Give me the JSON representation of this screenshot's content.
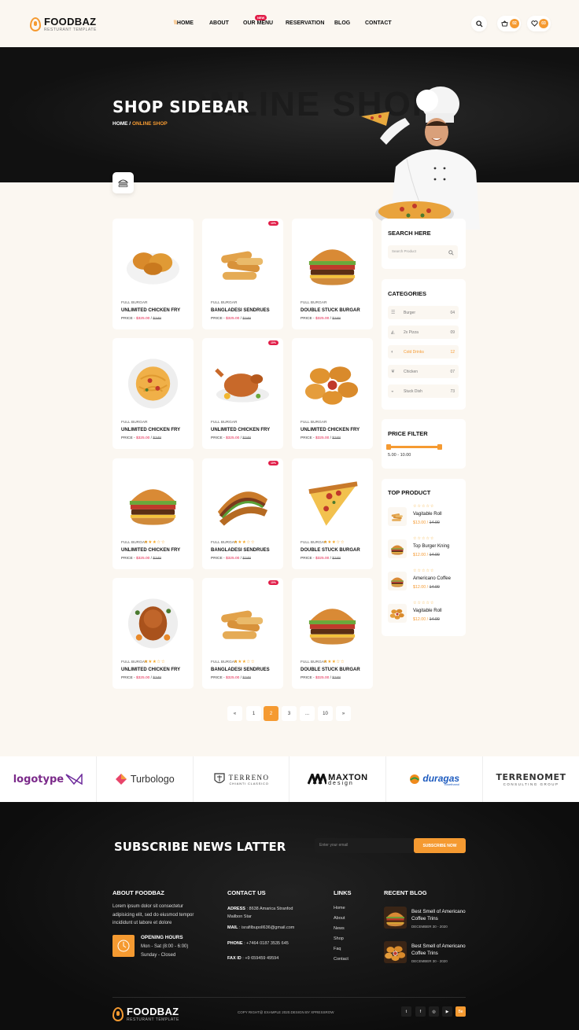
{
  "header": {
    "logo_text": "FOODBAZ",
    "logo_sub": "RESTURANT TEMPLATE",
    "nav": [
      "\\\\HOME",
      "ABOUT",
      "OUR MENU",
      "RESERVATION",
      "BLOG",
      "CONTACT"
    ],
    "new_badge": "NEW",
    "cart_count": "02",
    "wish_count": "03",
    "icons": [
      "search-icon",
      "basket-icon",
      "heart-icon"
    ]
  },
  "hero": {
    "bg_text": "ONLINE SHOP",
    "title": "SHOP SIDEBAR",
    "crumb_home": "HOME /",
    "crumb_current": "ONLINE SHOP"
  },
  "products": [
    {
      "cat": "FULL BURGAR",
      "name": "UNLIMITED CHICKEN FRY",
      "price_label": "PRICE - ",
      "price": "$325.00",
      "old": "$348",
      "badge": "",
      "stars": 0,
      "icon": "fried-chicken"
    },
    {
      "cat": "FULL BURGAR",
      "name": "BANGLADESI SENDRUES",
      "price_label": "PRICE - ",
      "price": "$325.00",
      "old": "$348",
      "badge": "10%",
      "stars": 0,
      "icon": "chicken-strips"
    },
    {
      "cat": "FULL BURGAR",
      "name": "DOUBLE STUCK BURGAR",
      "price_label": "PRICE - ",
      "price": "$325.00",
      "old": "$348",
      "badge": "",
      "stars": 0,
      "icon": "burger"
    },
    {
      "cat": "FULL BURGAR",
      "name": "UNLIMITED CHICKEN FRY",
      "price_label": "PRICE - ",
      "price": "$325.00",
      "old": "$348",
      "badge": "",
      "stars": 0,
      "icon": "spaghetti"
    },
    {
      "cat": "FULL BURGAR",
      "name": "UNLIMITED CHICKEN FRY",
      "price_label": "PRICE - ",
      "price": "$325.00",
      "old": "$348",
      "badge": "10%",
      "stars": 0,
      "icon": "roast-chicken"
    },
    {
      "cat": "FULL BURGAR",
      "name": "UNLIMITED CHICKEN FRY",
      "price_label": "PRICE - ",
      "price": "$325.00",
      "old": "$348",
      "badge": "",
      "stars": 0,
      "icon": "nuggets"
    },
    {
      "cat": "FULL BURGAR",
      "name": "UNLIMITED CHICKEN FRY",
      "price_label": "PRICE - ",
      "price": "$325.00",
      "old": "$348",
      "badge": "",
      "stars": 3,
      "icon": "burger"
    },
    {
      "cat": "FULL BURGAR",
      "name": "BANGLADESI SENDRUES",
      "price_label": "PRICE - ",
      "price": "$325.00",
      "old": "$348",
      "badge": "10%",
      "stars": 3,
      "icon": "sandwich"
    },
    {
      "cat": "FULL BURGAR",
      "name": "DOUBLE STUCK BURGAR",
      "price_label": "PRICE - ",
      "price": "$325.00",
      "old": "$348",
      "badge": "",
      "stars": 3,
      "icon": "pizza-slice"
    },
    {
      "cat": "FULL BURGAR",
      "name": "UNLIMITED CHICKEN FRY",
      "price_label": "PRICE - ",
      "price": "$325.00",
      "old": "$348",
      "badge": "",
      "stars": 3,
      "icon": "roast-turkey"
    },
    {
      "cat": "FULL BURGAR",
      "name": "BANGLADESI SENDRUES",
      "price_label": "PRICE - ",
      "price": "$325.00",
      "old": "$348",
      "badge": "10%",
      "stars": 3,
      "icon": "chicken-strips"
    },
    {
      "cat": "FULL BURGAR",
      "name": "DOUBLE STUCK BURGAR",
      "price_label": "PRICE - ",
      "price": "$325.00",
      "old": "$348",
      "badge": "",
      "stars": 3,
      "icon": "burger"
    }
  ],
  "sidebar": {
    "search_title": "SEARCH HERE",
    "search_placeholder": "Search Product",
    "categories_title": "CATEGORIES",
    "categories": [
      {
        "label": "Burger",
        "count": "04",
        "icon": "burger-icon"
      },
      {
        "label": "2x Pizza",
        "count": "09",
        "icon": "pizza-icon"
      },
      {
        "label": "Cold Drinks",
        "count": "12",
        "icon": "drink-icon",
        "active": true
      },
      {
        "label": "Chicken",
        "count": "07",
        "icon": "chicken-icon"
      },
      {
        "label": "Stuck Dish",
        "count": "73",
        "icon": "dish-icon"
      }
    ],
    "price_title": "PRICE FILTER",
    "price_range": "5.00 - 10.00",
    "price_fill_fraction": 1.0,
    "top_title": "TOP PRODUCT",
    "top_products": [
      {
        "name": "Vagitable Roll",
        "price": "$13.00 / ",
        "old": "14.90"
      },
      {
        "name": "Top Burger Kning",
        "price": "$12.00 / ",
        "old": "14.90"
      },
      {
        "name": "Americano Coffee",
        "price": "$12.00 / ",
        "old": "14.90"
      },
      {
        "name": "Vagitable Roll",
        "price": "$12.00 / ",
        "old": "14.90"
      }
    ]
  },
  "pagination": [
    "«",
    "1",
    "2",
    "3",
    "...",
    "10",
    "»"
  ],
  "pagination_active": "2",
  "brands": [
    "logotype",
    "Turbologo",
    "TERRENO",
    "MAXTON",
    "duragas",
    "TERRENOMET"
  ],
  "brand_subs": [
    "",
    "",
    "CHIANTI CLASSICO",
    "design",
    "Bioethanol",
    "CONSULTING GROUP"
  ],
  "footer": {
    "subscribe_title": "SUBSCRIBE NEWS LATTER",
    "email_placeholder": "Enter your email",
    "subscribe_btn": "SUBSCRIBE NOW",
    "about_title": "ABOUT FOODBAZ",
    "about_text": "Lorem ipsum dolor sit consectetur adipisicing elit, sed do eiusmod tempor incididunt ut labore et dolore",
    "hours_title": "OPENING HOURS",
    "hours_1": "Mon - Sat (8:00 - 6:00)",
    "hours_2": "Sunday - Closed",
    "contact_title": "CONTACT US",
    "address_label": "ADRESS",
    "address": " : 8638 Amarica Stranfod Mailbon Star",
    "mail_label": "MAIL",
    "mail": " : israfilbupoll636@gmail.com",
    "phone_label": "PHONE",
    "phone": " : +7464 0187 3535 645",
    "fax_label": "FAX ID",
    "fax": " : +9 659459 49594",
    "links_title": "LINKS",
    "links": [
      "Home",
      "About",
      "News",
      "Shop",
      "Faq",
      "Contact"
    ],
    "blog_title": "RECENT BLOG",
    "blogs": [
      {
        "title": "Best Smell of Americano Coffee Trins",
        "date": "DECEMBER 30 - 2020"
      },
      {
        "title": "Best Smell of Americano Coffee Trins",
        "date": "DECEMBER 30 - 2020"
      }
    ],
    "logo_text": "FOODBAZ",
    "logo_sub": "RESTURANT TEMPLATE",
    "copyright": "COPY RIGHT@ EXAMPLE 2020.DESIGN BY XPRESSROW",
    "social": [
      "t",
      "f",
      "◎",
      "▶",
      "Be"
    ]
  },
  "colors": {
    "accent": "#f59a31",
    "badge": "#e11d48",
    "star": "#f5a623",
    "dark": "#111111",
    "cream": "#fbf7f1"
  }
}
